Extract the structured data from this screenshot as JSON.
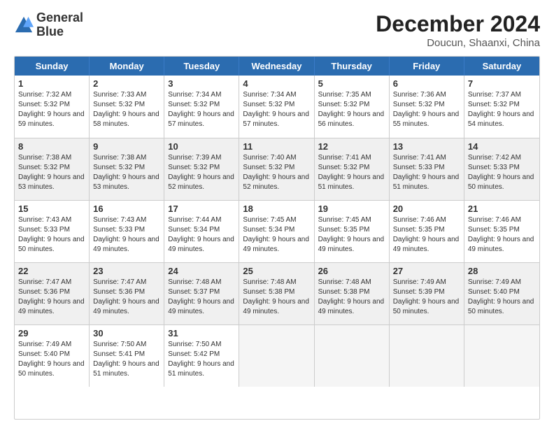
{
  "header": {
    "logo_line1": "General",
    "logo_line2": "Blue",
    "title": "December 2024",
    "subtitle": "Doucun, Shaanxi, China"
  },
  "calendar": {
    "weekdays": [
      "Sunday",
      "Monday",
      "Tuesday",
      "Wednesday",
      "Thursday",
      "Friday",
      "Saturday"
    ],
    "weeks": [
      [
        {
          "day": "1",
          "sunrise": "7:32 AM",
          "sunset": "5:32 PM",
          "daylight": "9 hours and 59 minutes."
        },
        {
          "day": "2",
          "sunrise": "7:33 AM",
          "sunset": "5:32 PM",
          "daylight": "9 hours and 58 minutes."
        },
        {
          "day": "3",
          "sunrise": "7:34 AM",
          "sunset": "5:32 PM",
          "daylight": "9 hours and 57 minutes."
        },
        {
          "day": "4",
          "sunrise": "7:34 AM",
          "sunset": "5:32 PM",
          "daylight": "9 hours and 57 minutes."
        },
        {
          "day": "5",
          "sunrise": "7:35 AM",
          "sunset": "5:32 PM",
          "daylight": "9 hours and 56 minutes."
        },
        {
          "day": "6",
          "sunrise": "7:36 AM",
          "sunset": "5:32 PM",
          "daylight": "9 hours and 55 minutes."
        },
        {
          "day": "7",
          "sunrise": "7:37 AM",
          "sunset": "5:32 PM",
          "daylight": "9 hours and 54 minutes."
        }
      ],
      [
        {
          "day": "8",
          "sunrise": "7:38 AM",
          "sunset": "5:32 PM",
          "daylight": "9 hours and 53 minutes."
        },
        {
          "day": "9",
          "sunrise": "7:38 AM",
          "sunset": "5:32 PM",
          "daylight": "9 hours and 53 minutes."
        },
        {
          "day": "10",
          "sunrise": "7:39 AM",
          "sunset": "5:32 PM",
          "daylight": "9 hours and 52 minutes."
        },
        {
          "day": "11",
          "sunrise": "7:40 AM",
          "sunset": "5:32 PM",
          "daylight": "9 hours and 52 minutes."
        },
        {
          "day": "12",
          "sunrise": "7:41 AM",
          "sunset": "5:32 PM",
          "daylight": "9 hours and 51 minutes."
        },
        {
          "day": "13",
          "sunrise": "7:41 AM",
          "sunset": "5:33 PM",
          "daylight": "9 hours and 51 minutes."
        },
        {
          "day": "14",
          "sunrise": "7:42 AM",
          "sunset": "5:33 PM",
          "daylight": "9 hours and 50 minutes."
        }
      ],
      [
        {
          "day": "15",
          "sunrise": "7:43 AM",
          "sunset": "5:33 PM",
          "daylight": "9 hours and 50 minutes."
        },
        {
          "day": "16",
          "sunrise": "7:43 AM",
          "sunset": "5:33 PM",
          "daylight": "9 hours and 49 minutes."
        },
        {
          "day": "17",
          "sunrise": "7:44 AM",
          "sunset": "5:34 PM",
          "daylight": "9 hours and 49 minutes."
        },
        {
          "day": "18",
          "sunrise": "7:45 AM",
          "sunset": "5:34 PM",
          "daylight": "9 hours and 49 minutes."
        },
        {
          "day": "19",
          "sunrise": "7:45 AM",
          "sunset": "5:35 PM",
          "daylight": "9 hours and 49 minutes."
        },
        {
          "day": "20",
          "sunrise": "7:46 AM",
          "sunset": "5:35 PM",
          "daylight": "9 hours and 49 minutes."
        },
        {
          "day": "21",
          "sunrise": "7:46 AM",
          "sunset": "5:35 PM",
          "daylight": "9 hours and 49 minutes."
        }
      ],
      [
        {
          "day": "22",
          "sunrise": "7:47 AM",
          "sunset": "5:36 PM",
          "daylight": "9 hours and 49 minutes."
        },
        {
          "day": "23",
          "sunrise": "7:47 AM",
          "sunset": "5:36 PM",
          "daylight": "9 hours and 49 minutes."
        },
        {
          "day": "24",
          "sunrise": "7:48 AM",
          "sunset": "5:37 PM",
          "daylight": "9 hours and 49 minutes."
        },
        {
          "day": "25",
          "sunrise": "7:48 AM",
          "sunset": "5:38 PM",
          "daylight": "9 hours and 49 minutes."
        },
        {
          "day": "26",
          "sunrise": "7:48 AM",
          "sunset": "5:38 PM",
          "daylight": "9 hours and 49 minutes."
        },
        {
          "day": "27",
          "sunrise": "7:49 AM",
          "sunset": "5:39 PM",
          "daylight": "9 hours and 50 minutes."
        },
        {
          "day": "28",
          "sunrise": "7:49 AM",
          "sunset": "5:40 PM",
          "daylight": "9 hours and 50 minutes."
        }
      ],
      [
        {
          "day": "29",
          "sunrise": "7:49 AM",
          "sunset": "5:40 PM",
          "daylight": "9 hours and 50 minutes."
        },
        {
          "day": "30",
          "sunrise": "7:50 AM",
          "sunset": "5:41 PM",
          "daylight": "9 hours and 51 minutes."
        },
        {
          "day": "31",
          "sunrise": "7:50 AM",
          "sunset": "5:42 PM",
          "daylight": "9 hours and 51 minutes."
        },
        {
          "day": "",
          "sunrise": "",
          "sunset": "",
          "daylight": ""
        },
        {
          "day": "",
          "sunrise": "",
          "sunset": "",
          "daylight": ""
        },
        {
          "day": "",
          "sunrise": "",
          "sunset": "",
          "daylight": ""
        },
        {
          "day": "",
          "sunrise": "",
          "sunset": "",
          "daylight": ""
        }
      ]
    ]
  }
}
